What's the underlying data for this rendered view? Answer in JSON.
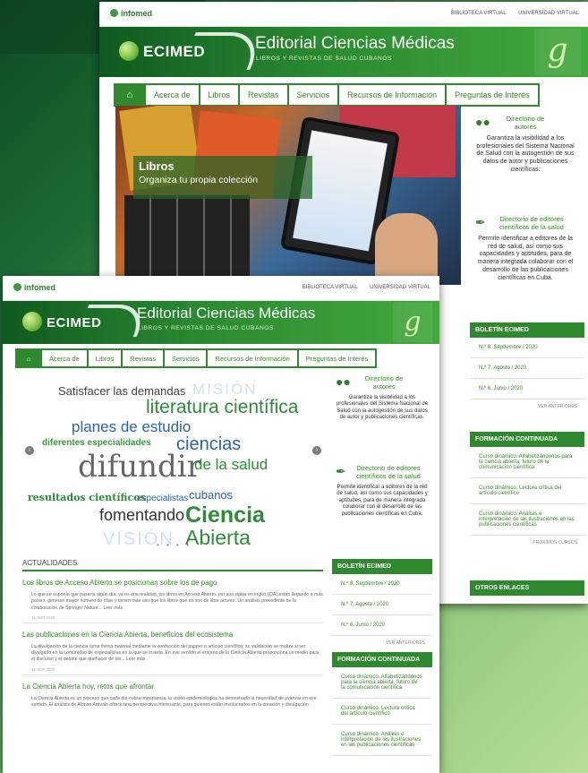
{
  "header": {
    "infomed": "infomed",
    "link_bv": "BIBLIOTECA VIRTUAL",
    "link_uv": "UNIVERSIDAD VIRTUAL",
    "brand": "ECIMED",
    "title": "Editorial Ciencias Médicas",
    "subtitle": "LIBROS Y REVISTAS DE SALUD CUBANOS"
  },
  "nav": {
    "home_icon": "home-icon",
    "items": [
      "Acerca de",
      "Libros",
      "Revistas",
      "Servicios",
      "Recursos de Información",
      "Preguntas de Interés"
    ]
  },
  "hero_back": {
    "title": "Libros",
    "subtitle": "Organiza tu propia colección"
  },
  "sidebar": {
    "dir_autores_title": "Directorio de autores",
    "dir_autores_text": "Garantiza la visibilidad a los profesionales del Sistema Nacional de Salud con la autogestión de sus datos de autor y publicaciones científicas.",
    "dir_editores_title": "Directorio de editores científicos de la salud",
    "dir_editores_text": "Permite identificar a editores de la red de salud, así como sus capacidades y aptitudes, para de manera integrada colaborar con el desarrollo de las publicaciones científicas en Cuba.",
    "boletin_title": "BOLETÍN ECIMED",
    "boletin_items": [
      "N.º 8. Septiembre / 2020",
      "N.º 7. Agosto / 2020",
      "N.º 6. Junio / 2020"
    ],
    "boletin_more": "VER ANTERIORES",
    "formacion_title": "FORMACIÓN CONTINUADA",
    "formacion_items": [
      "Curso dinámico. Alfabetizándonos para la ciencia abierta, futuro de la comunicación científica",
      "Curso dinámico. Lectura crítica del artículo científico",
      "Curso dinámico. Análisis e interpretación de las ilustraciones en las publicaciones científicas"
    ],
    "formacion_more": "PRÓXIMOS CURSOS",
    "otros_title": "OTROS ENLACES"
  },
  "wordcloud": {
    "w1": "Satisfacer las demandas",
    "w2": "MISIÓN",
    "w3": "literatura científica",
    "w4": "planes de estudio",
    "w5": "diferentes especialidades",
    "w6": "ciencias",
    "w7": "difundir",
    "w8": "de la salud",
    "w9": "resultados científicos",
    "w10": "especialistas",
    "w11": "cubanos",
    "w12": "fomentando",
    "w13": "Ciencia",
    "w14": "VISIÓN",
    "w15": "Abierta",
    "dots": "• • • •"
  },
  "news": {
    "heading": "ACTUALIDADES",
    "articles": [
      {
        "title": "Los libros de Acceso Abierto se posicionan sobre los de pago",
        "body": "Lo que se suponía que pasaría algún día, ya es una realidad, los libros en Acceso Abierto, por sus siglas en inglés (OA) están llegando a más países, generan mayor número de citas y tienen más uso que los libros que no son de libre acceso. Un análisis procedente de la colaboración de Springer Nature... Leer más",
        "date": "15 SEP 2020"
      },
      {
        "title": "Las publicaciones en la Ciencia Abierta, beneficios del ecosistema",
        "body": "La divulgación de la ciencia toma forma material mediante la confección del papper o artículo científico; su validación se realiza si ser divulgado en la comunidad de especialistas en la que se inserta. En ese sentido el entorno de la Ciencia Abierta proporciona un medio para el discurso y el debate que quehacer de los... Leer más",
        "date": "15 SEP 2020"
      },
      {
        "title": "La Ciencia Abierta hoy, retos que afrontar",
        "body": "La Ciencia Abierta es un proceso que cada día cobra importancia, la visión epidemiológica ha demostrado la necesidad de avanzar en ese sentido. El análisis de Alonso Arévalo ofrece una perspectiva interesante, para quienes están involucrados en la creación y divulgación",
        "date": ""
      }
    ]
  }
}
